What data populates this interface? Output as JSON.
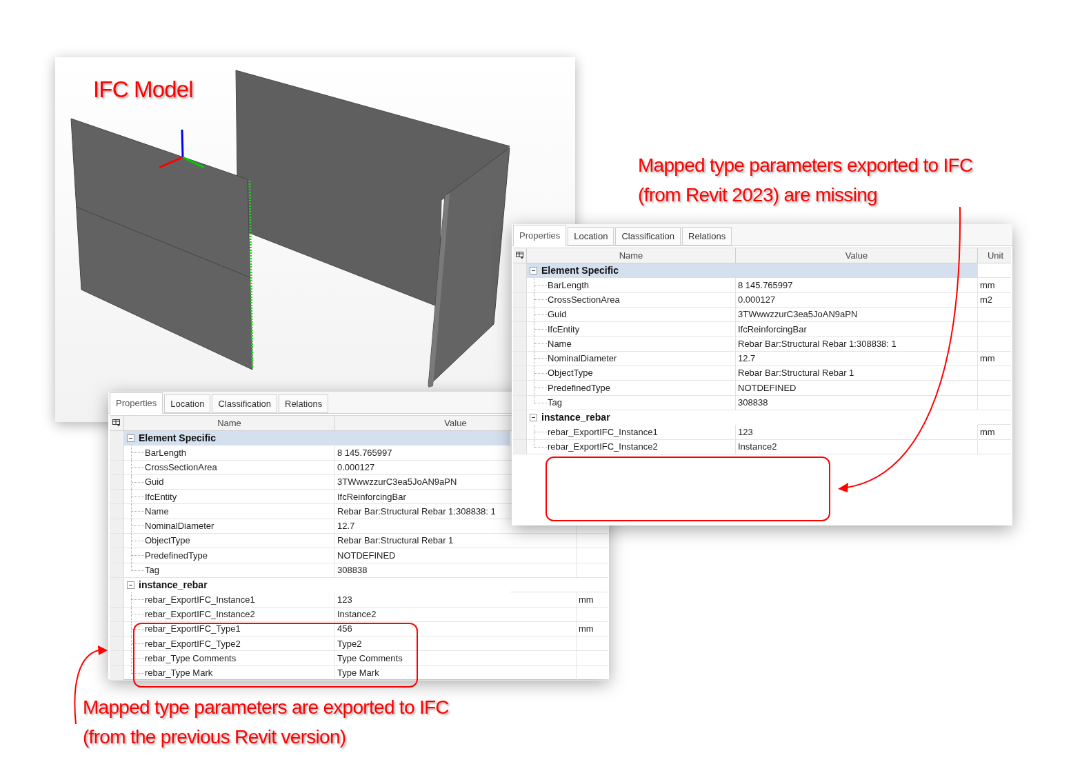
{
  "model_view": {
    "title": "IFC Model"
  },
  "panels": [
    {
      "tabs": [
        {
          "label": "Properties",
          "selected": true
        },
        {
          "label": "Location",
          "selected": false
        },
        {
          "label": "Classification",
          "selected": false
        },
        {
          "label": "Relations",
          "selected": false
        }
      ],
      "columns": [
        "Name",
        "Value"
      ],
      "groups": [
        {
          "title": "Element Specific",
          "selected": true,
          "expanded": true,
          "rows": [
            {
              "name": "BarLength",
              "value": "8 145.765997"
            },
            {
              "name": "CrossSectionArea",
              "value": "0.000127"
            },
            {
              "name": "Guid",
              "value": "3TWwwzzurC3ea5JoAN9aPN"
            },
            {
              "name": "IfcEntity",
              "value": "IfcReinforcingBar"
            },
            {
              "name": "Name",
              "value": "Rebar Bar:Structural Rebar 1:308838: 1"
            },
            {
              "name": "NominalDiameter",
              "value": "12.7"
            },
            {
              "name": "ObjectType",
              "value": "Rebar Bar:Structural Rebar 1"
            },
            {
              "name": "PredefinedType",
              "value": "NOTDEFINED"
            },
            {
              "name": "Tag",
              "value": "308838"
            }
          ]
        },
        {
          "title": "instance_rebar",
          "selected": false,
          "expanded": true,
          "rows": [
            {
              "name": "rebar_ExportIFC_Instance1",
              "value": "123",
              "unit": "mm"
            },
            {
              "name": "rebar_ExportIFC_Instance2",
              "value": "Instance2"
            },
            {
              "name": "rebar_ExportIFC_Type1",
              "value": "456",
              "unit": "mm"
            },
            {
              "name": "rebar_ExportIFC_Type2",
              "value": "Type2"
            },
            {
              "name": "rebar_Type Comments",
              "value": "Type Comments"
            },
            {
              "name": "rebar_Type Mark",
              "value": "Type Mark"
            }
          ]
        }
      ]
    },
    {
      "tabs": [
        {
          "label": "Properties",
          "selected": true
        },
        {
          "label": "Location",
          "selected": false
        },
        {
          "label": "Classification",
          "selected": false
        },
        {
          "label": "Relations",
          "selected": false
        }
      ],
      "columns": [
        "Name",
        "Value",
        "Unit"
      ],
      "groups": [
        {
          "title": "Element Specific",
          "selected": true,
          "expanded": true,
          "rows": [
            {
              "name": "BarLength",
              "value": "8 145.765997",
              "unit": "mm"
            },
            {
              "name": "CrossSectionArea",
              "value": "0.000127",
              "unit": "m2"
            },
            {
              "name": "Guid",
              "value": "3TWwwzzurC3ea5JoAN9aPN"
            },
            {
              "name": "IfcEntity",
              "value": "IfcReinforcingBar"
            },
            {
              "name": "Name",
              "value": "Rebar Bar:Structural Rebar 1:308838: 1"
            },
            {
              "name": "NominalDiameter",
              "value": "12.7",
              "unit": "mm"
            },
            {
              "name": "ObjectType",
              "value": "Rebar Bar:Structural Rebar 1"
            },
            {
              "name": "PredefinedType",
              "value": "NOTDEFINED"
            },
            {
              "name": "Tag",
              "value": "308838"
            }
          ]
        },
        {
          "title": "instance_rebar",
          "selected": false,
          "expanded": true,
          "rows": [
            {
              "name": "rebar_ExportIFC_Instance1",
              "value": "123",
              "unit": "mm"
            },
            {
              "name": "rebar_ExportIFC_Instance2",
              "value": "Instance2"
            }
          ]
        }
      ]
    }
  ],
  "annotations": [
    {
      "lines": [
        "Mapped type parameters exported to IFC",
        "(from Revit 2023) are missing"
      ]
    },
    {
      "lines": [
        "Mapped type parameters are exported to IFC",
        "(from the previous Revit version)"
      ]
    }
  ]
}
